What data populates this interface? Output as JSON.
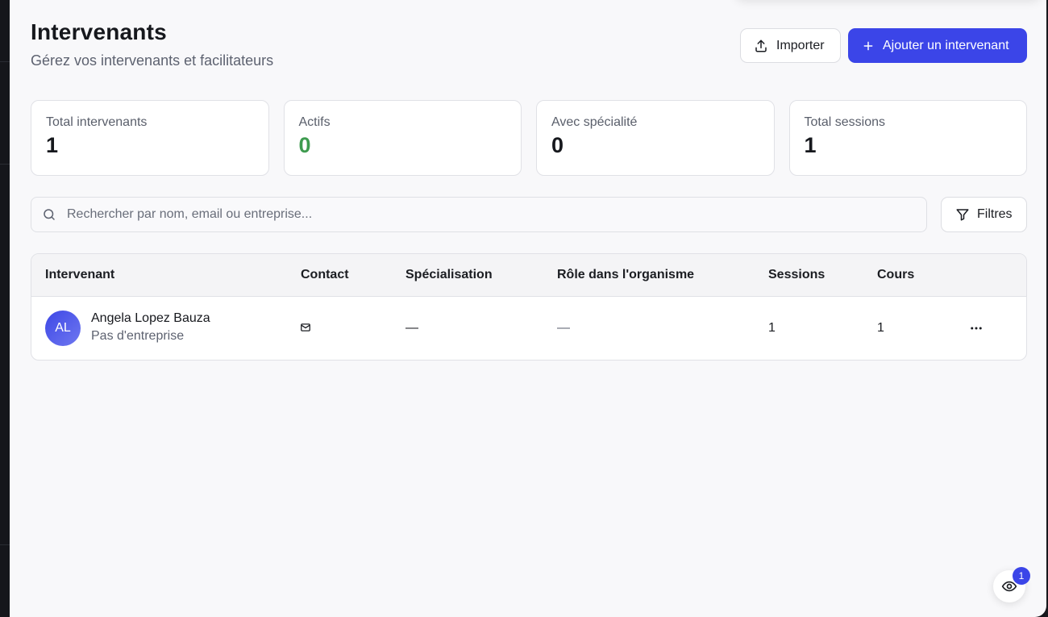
{
  "header": {
    "title": "Intervenants",
    "subtitle": "Gérez vos intervenants et facilitateurs"
  },
  "actions": {
    "import_label": "Importer",
    "add_label": "Ajouter un intervenant"
  },
  "stats": [
    {
      "label": "Total intervenants",
      "value": "1"
    },
    {
      "label": "Actifs",
      "value": "0"
    },
    {
      "label": "Avec spécialité",
      "value": "0"
    },
    {
      "label": "Total sessions",
      "value": "1"
    }
  ],
  "search": {
    "placeholder": "Rechercher par nom, email ou entreprise...",
    "value": ""
  },
  "filter": {
    "label": "Filtres"
  },
  "table": {
    "columns": [
      "Intervenant",
      "Contact",
      "Spécialisation",
      "Rôle dans l'organisme",
      "Sessions",
      "Cours"
    ],
    "rows": [
      {
        "initials": "AL",
        "name": "Angela Lopez Bauza",
        "company": "Pas d'entreprise",
        "specialisation": "—",
        "role": "—",
        "sessions": "1",
        "cours": "1"
      }
    ]
  },
  "fab": {
    "badge": "1"
  },
  "colors": {
    "accent": "#3b45e8",
    "active_green": "#3e9b4f",
    "background": "#f8f8fa"
  },
  "icons": [
    "upload-icon",
    "plus-icon",
    "search-icon",
    "filter-icon",
    "mail-icon",
    "more-horizontal-icon",
    "eye-icon"
  ]
}
